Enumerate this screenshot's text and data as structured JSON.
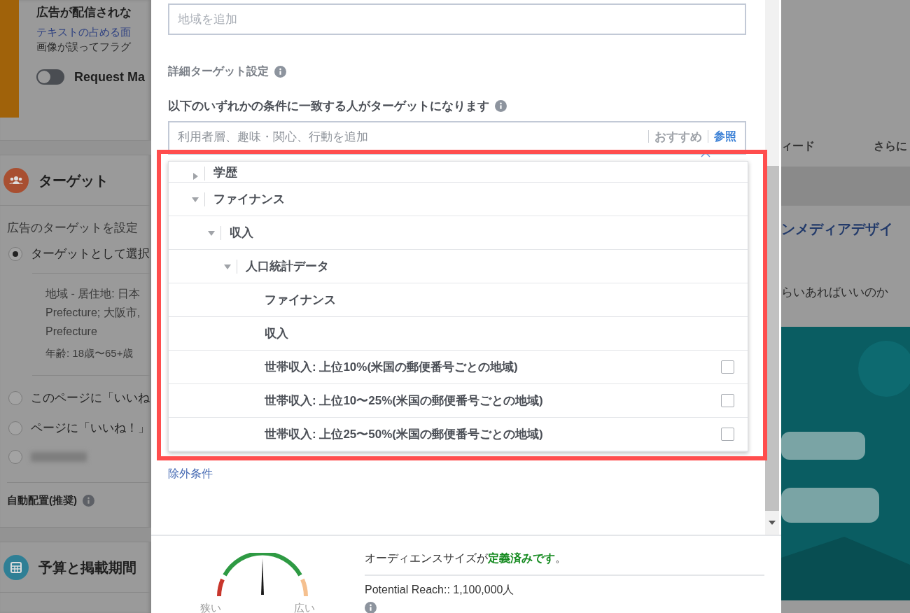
{
  "background_page": {
    "banner": {
      "title": "広告が配信されな",
      "link": "テキストの占める面",
      "text": "画像が誤ってフラグ",
      "toggle": {
        "label": "Request Ma",
        "on": false
      }
    },
    "target_section": {
      "title": "ターゲット",
      "description": "広告のターゲットを設定",
      "options": [
        {
          "label": "ターゲットとして選択",
          "selected": true,
          "details": [
            "地域 - 居住地: 日本",
            "Prefecture; 大阪市,",
            "Prefecture",
            "年齢: 18歳〜65+歳"
          ]
        },
        {
          "label": "このページに「いいね",
          "selected": false
        },
        {
          "label": "ページに「いいね！」",
          "selected": false
        },
        {
          "kind": "blurred",
          "selected": false
        }
      ]
    },
    "placement": {
      "label": "自動配置(推奨)"
    },
    "budget_section": {
      "title": "予算と掲載期間"
    },
    "right": {
      "tabs": [
        "ィード",
        "さらに"
      ],
      "title": "ンメディアデザイ",
      "text": "らいあればいいのか"
    }
  },
  "dialog": {
    "location_field": {
      "placeholder": "地域を追加"
    },
    "detailed_targeting": {
      "title": "詳細ターゲット設定",
      "subtitle": "以下のいずれかの条件に一致する人がターゲットになります",
      "field": {
        "placeholder": "利用者層、趣味・関心、行動を追加",
        "suggest": "おすすめ",
        "browse": "参照"
      },
      "tree": [
        {
          "label": "学歴",
          "expanded": false
        },
        {
          "label": "ファイナンス",
          "expanded": true,
          "children": [
            {
              "label": "収入",
              "expanded": true,
              "children": [
                {
                  "label": "人口統計データ",
                  "expanded": true,
                  "children": [
                    {
                      "label": "ファイナンス",
                      "kind": "header"
                    },
                    {
                      "label": "収入",
                      "kind": "header"
                    },
                    {
                      "label": "世帯収入: 上位10%(米国の郵便番号ごとの地域)",
                      "kind": "option",
                      "checked": false
                    },
                    {
                      "label": "世帯収入: 上位10〜25%(米国の郵便番号ごとの地域)",
                      "kind": "option",
                      "checked": false
                    },
                    {
                      "label": "世帯収入: 上位25〜50%(米国の郵便番号ごとの地域)",
                      "kind": "option",
                      "checked": false
                    }
                  ]
                }
              ]
            }
          ]
        }
      ],
      "exclude_link": "除外条件"
    },
    "audience": {
      "message": "オーディエンスサイズが**定義済みです**。",
      "reach": "Potential Reach:: 1,100,000人",
      "gauge": {
        "narrow": "狭い",
        "wide": "広い"
      }
    }
  }
}
